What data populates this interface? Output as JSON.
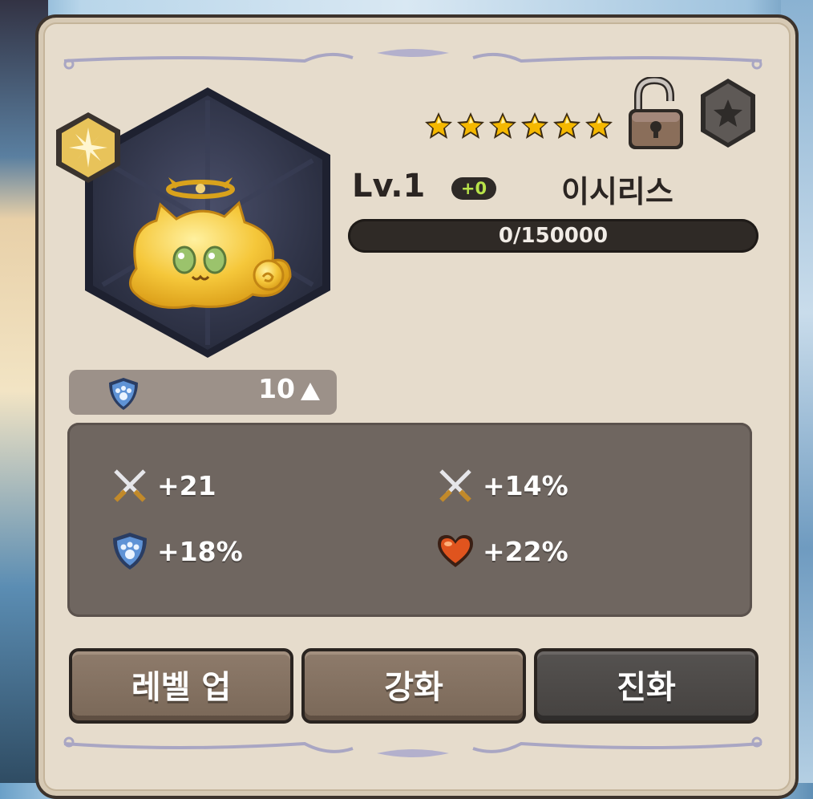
{
  "pet": {
    "level": "Lv.1",
    "enhance": "+0",
    "name": "이시리스",
    "stars": 6,
    "exp_text": "0/150000",
    "exp_fraction": 0
  },
  "power": {
    "icon": "shield-paw-icon",
    "value": "10"
  },
  "stats": [
    {
      "icon": "crossed-swords-icon",
      "value": "+21"
    },
    {
      "icon": "crossed-swords-icon",
      "value": "+14%"
    },
    {
      "icon": "shield-paw-icon",
      "value": "+18%"
    },
    {
      "icon": "heart-icon",
      "value": "+22%"
    }
  ],
  "buttons": {
    "level_up": "레벨 업",
    "enhance": "강화",
    "evolve": "진화"
  },
  "colors": {
    "panel": "#e6dccc",
    "accent_green": "#b8e34a",
    "star_gold": "#f5b800",
    "hex_bg": "#2f3346"
  }
}
